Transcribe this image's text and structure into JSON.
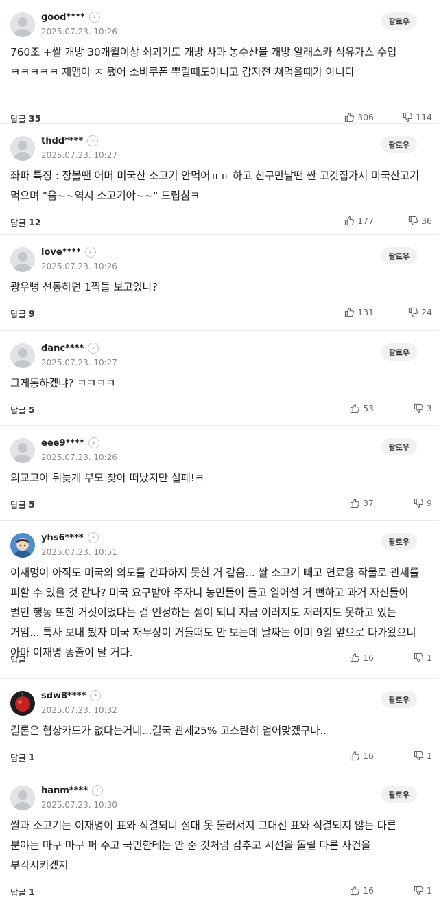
{
  "labels": {
    "follow": "팔로우",
    "reply": "답글"
  },
  "comments": [
    {
      "nickname": "good****",
      "date": "2025.07.23. 10:26",
      "text": "760조 +쌀 개방 30개월이상 쇠괴기도 개방 사과 농수산물 개방 알래스카 석유가스 수입 ㅋㅋㅋㅋㅋ 재맴아 ㅈ 됐어 소비쿠폰 뿌릴때도아니고 감자전 쳐먹을때가 아니다",
      "replies": "35",
      "likes": "306",
      "dislikes": "114",
      "avatar": "default"
    },
    {
      "nickname": "thdd****",
      "date": "2025.07.23. 10:27",
      "text": "좌파 특징 : 장볼땐 어머 미국산 소고기 안먹어ㅠㅠ 하고 친구만날땐 싼 고깃집가서 미국산고기 먹으며 \"음~~역시 소고기야~~\" 드립침ㅋ",
      "replies": "12",
      "likes": "177",
      "dislikes": "36",
      "avatar": "default"
    },
    {
      "nickname": "love****",
      "date": "2025.07.23. 10:26",
      "text": "광우뻥 선동하던 1찍들 보고있나?",
      "replies": "9",
      "likes": "131",
      "dislikes": "24",
      "avatar": "default"
    },
    {
      "nickname": "danc****",
      "date": "2025.07.23. 10:27",
      "text": "그게통하겠냐? ㅋㅋㅋㅋ",
      "replies": "5",
      "likes": "53",
      "dislikes": "3",
      "avatar": "default"
    },
    {
      "nickname": "eee9****",
      "date": "2025.07.23. 10:26",
      "text": "외교고아 뒤늦게 부모 찾아 떠났지만 실패!ㅋ",
      "replies": "5",
      "likes": "37",
      "dislikes": "9",
      "avatar": "default"
    },
    {
      "nickname": "yhs6****",
      "date": "2025.07.23. 10:51",
      "text": "이재명이 아직도 미국의 의도를 간파하지 못한 거 같음... 쌀 소고기 빼고 연료용 작물로 관세를 피할 수 있을 것 같나? 미국 요구받아 주자니 농민들이 들고 일어설 거 뻔하고 과거 자신들이 벌인 행동 또한 거짓이었다는 걸 인정하는 셈이 되니 지금 이러지도 저러지도 못하고 있는 거임... 특사 보내 봤자 미국 재무상이 거들떠도 안 보는데 날짜는 이미 9일 앞으로 다가왔으니 아마 이재명 똥줄이 탈 거다.",
      "replies": "",
      "likes": "16",
      "dislikes": "1",
      "avatar": "cartoon"
    },
    {
      "nickname": "sdw8****",
      "date": "2025.07.23. 10:32",
      "text": "결론은 협상카드가 없다는거네...결국 관세25% 고스란히 얻어맞겠구나..",
      "replies": "1",
      "likes": "16",
      "dislikes": "1",
      "avatar": "red"
    },
    {
      "nickname": "hanm****",
      "date": "2025.07.23. 10:30",
      "text": "쌀과 소고기는 이재명이 표와 직결되니 절대 못 물러서지 그대신 표와 직결되지 않는 다른 분야는 마구 마구 퍼 주고 국민한테는 안 준 것처럼 감추고 시선을 돌릴 다른 사건을 부각시키겠지",
      "replies": "1",
      "likes": "16",
      "dislikes": "1",
      "avatar": "default"
    }
  ]
}
